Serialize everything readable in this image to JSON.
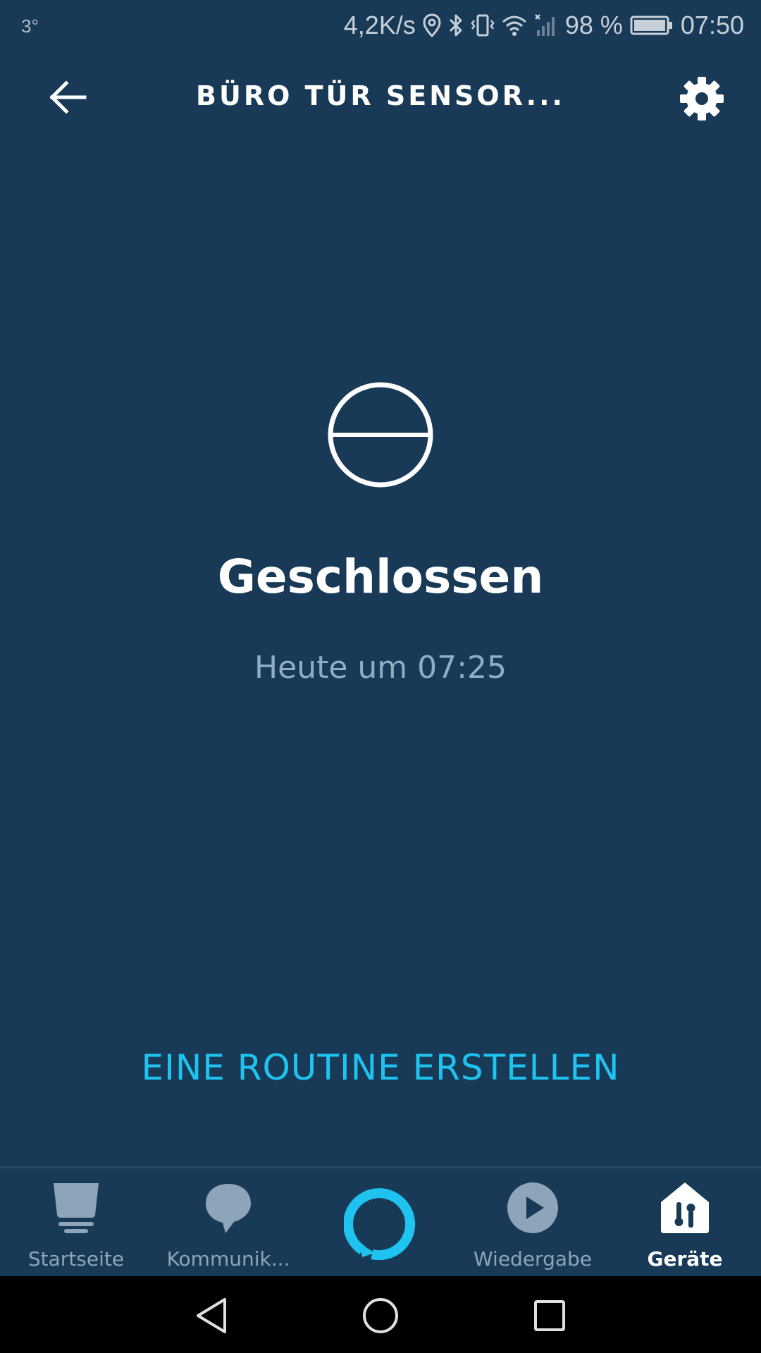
{
  "status_bar": {
    "temperature": "3°",
    "net_speed": "4,2K/s",
    "battery": "98 %",
    "time": "07:50"
  },
  "header": {
    "title": "BÜRO TÜR SENSOR...",
    "back_icon": "arrow-left-icon",
    "settings_icon": "gear-icon"
  },
  "sensor": {
    "state": "Geschlossen",
    "last_change": "Heute um 07:25",
    "icon": "contact-closed-icon"
  },
  "actions": {
    "create_routine": "EINE ROUTINE ERSTELLEN"
  },
  "bottom_nav": {
    "items": [
      {
        "label": "Startseite",
        "icon": "home-icon",
        "active": false
      },
      {
        "label": "Kommunik...",
        "icon": "chat-bubble-icon",
        "active": false
      },
      {
        "label": "",
        "icon": "alexa-ring-icon",
        "active": false
      },
      {
        "label": "Wiedergabe",
        "icon": "play-icon",
        "active": false
      },
      {
        "label": "Geräte",
        "icon": "devices-icon",
        "active": true
      }
    ]
  },
  "colors": {
    "background": "#183a56",
    "accent": "#1ec3f0",
    "muted_text": "#8eaec6",
    "nav_inactive": "#8ea4b8"
  }
}
